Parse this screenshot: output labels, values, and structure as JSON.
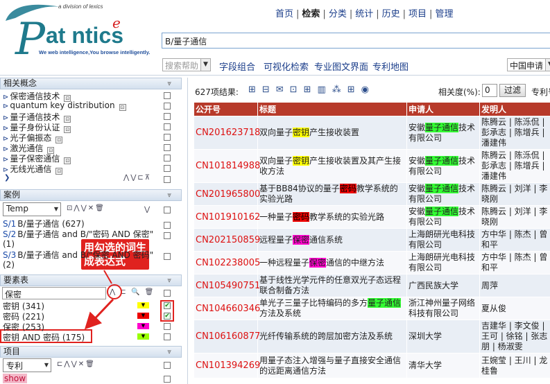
{
  "logo": {
    "tagline_top": "a division of lexics",
    "brand": "Patentics",
    "tagline_bottom": "We web intelligence,You browse intelligently."
  },
  "nav": {
    "items": [
      "首页",
      "检索",
      "分类",
      "统计",
      "历史",
      "项目",
      "管理"
    ],
    "current": "检索"
  },
  "query": {
    "value": "B/量子通信"
  },
  "toolbar": {
    "help_select": "搜索帮助",
    "links": [
      "字段组合",
      "可视化检索",
      "专业图文界面",
      "专利地图"
    ],
    "db_select": "中国申请"
  },
  "results_bar": {
    "count": "627项结果:",
    "relevance_label": "相关度(%):",
    "relevance_value": "0",
    "filter_button": "过滤",
    "sort_label": "专利号"
  },
  "left": {
    "related_title": "相关概念",
    "related": [
      "保密通信技术",
      "quantum key distribution",
      "量子通信技术",
      "量子身份认证",
      "光子偏振态",
      "激光通信",
      "量子保密通信",
      "无线光通信"
    ],
    "cases_title": "案例",
    "case_select": "Temp",
    "cases": [
      {
        "id": "S/1",
        "text": "B/量子通信 (627)"
      },
      {
        "id": "S/2",
        "text": "B/量子通信 and B/\"密码 AND 保密\" (1)"
      },
      {
        "id": "S/3",
        "text": "B/量子通信 and B/\"保密 AND 密码\" (2)"
      }
    ],
    "elements_title": "要素表",
    "element_input": "保密",
    "elements": [
      {
        "label": "密钥 (341)",
        "checked": true
      },
      {
        "label": "密码 (221)",
        "checked": true
      },
      {
        "label": "保密 (253)",
        "checked": false
      },
      {
        "label": "密钥 AND 密码 (175)",
        "checked": false
      }
    ],
    "project_title": "项目",
    "project_select": "专利",
    "show_label": "show"
  },
  "annotation": {
    "callout": "用勾选的词生成表达式"
  },
  "table": {
    "headers": [
      "公开号",
      "标题",
      "申请人",
      "发明人"
    ],
    "rows": [
      {
        "pn": "CN201623718",
        "title": [
          {
            "t": "双向量子"
          },
          {
            "t": "密钥",
            "h": "y"
          },
          {
            "t": "产生接收装置"
          }
        ],
        "applicant": [
          {
            "t": "安徽"
          },
          {
            "t": "量子通信",
            "h": "g"
          },
          {
            "t": "技术有限公司"
          }
        ],
        "inventor": "陈腾云 | 陈泺侃 | 彭承志 | 陈增兵 | 潘建伟"
      },
      {
        "pn": "CN101814988",
        "title": [
          {
            "t": "双向量子"
          },
          {
            "t": "密钥",
            "h": "y"
          },
          {
            "t": "产生接收装置及其产生接收方法"
          }
        ],
        "applicant": [
          {
            "t": "安徽"
          },
          {
            "t": "量子通信",
            "h": "g"
          },
          {
            "t": "技术有限公司"
          }
        ],
        "inventor": "陈腾云 | 陈泺侃 | 彭承志 | 陈增兵 | 潘建伟"
      },
      {
        "pn": "CN201965800",
        "title": [
          {
            "t": "基于BB84协议的量子"
          },
          {
            "t": "密码",
            "h": "r"
          },
          {
            "t": "教学系统的实验光路"
          }
        ],
        "applicant": [
          {
            "t": "安徽"
          },
          {
            "t": "量子通信",
            "h": "g"
          },
          {
            "t": "技术有限公司"
          }
        ],
        "inventor": "陈腾云 | 刘洋 | 李晓刚"
      },
      {
        "pn": "CN101910162",
        "title": [
          {
            "t": "一种量子"
          },
          {
            "t": "密码",
            "h": "r"
          },
          {
            "t": "教学系统的实验光路"
          }
        ],
        "applicant": [
          {
            "t": "安徽"
          },
          {
            "t": "量子通信",
            "h": "g"
          },
          {
            "t": "技术有限公司"
          }
        ],
        "inventor": "陈腾云 | 刘洋 | 李晓刚"
      },
      {
        "pn": "CN202150859",
        "title": [
          {
            "t": "远程量子"
          },
          {
            "t": "保密",
            "h": "p"
          },
          {
            "t": "通信系统"
          }
        ],
        "applicant": [
          {
            "t": "上海朗研光电科技有限公司"
          }
        ],
        "inventor": "方中华 | 陈杰 | 曾和平"
      },
      {
        "pn": "CN102238005",
        "title": [
          {
            "t": "一种远程量子"
          },
          {
            "t": "保密",
            "h": "p"
          },
          {
            "t": "通信的中继方法"
          }
        ],
        "applicant": [
          {
            "t": "上海朗研光电科技有限公司"
          }
        ],
        "inventor": "方中华 | 陈杰 | 曾和平"
      },
      {
        "pn": "CN105490751",
        "title": [
          {
            "t": "基于线性光学元件的任意双光子态远程联合制备方法"
          }
        ],
        "applicant": [
          {
            "t": "广西民族大学"
          }
        ],
        "inventor": "周萍"
      },
      {
        "pn": "CN104660346",
        "title": [
          {
            "t": "单光子三量子比特编码的多方"
          },
          {
            "t": "量子通信",
            "h": "g"
          },
          {
            "t": "方法及系统"
          }
        ],
        "applicant": [
          {
            "t": "浙江神州量子网络科技有限公司"
          }
        ],
        "inventor": "夏从俊"
      },
      {
        "pn": "CN106160877",
        "title": [
          {
            "t": "光纤传输系统的跨层加密方法及系统"
          }
        ],
        "applicant": [
          {
            "t": "深圳大学"
          }
        ],
        "inventor": "吉建华 | 李文俊 | 王可 | 徐铭 | 张志朋 | 杨淑雯"
      },
      {
        "pn": "CN101394269",
        "title": [
          {
            "t": "用量子态注入增强与量子直接安全通信的远距离通信方法"
          }
        ],
        "applicant": [
          {
            "t": "清华大学"
          }
        ],
        "inventor": "王婉莹 | 王川 | 龙桂鲁"
      }
    ]
  }
}
